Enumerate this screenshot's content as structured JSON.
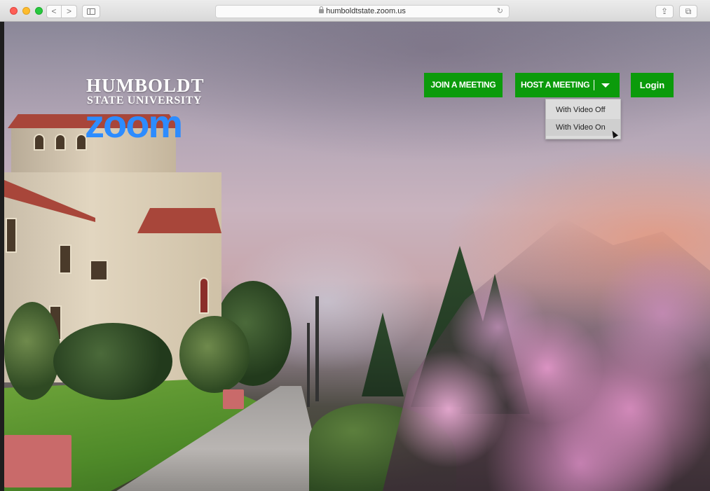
{
  "browser": {
    "url": "humboldtstate.zoom.us",
    "back_glyph": "<",
    "forward_glyph": ">",
    "reload_glyph": "↻",
    "share_glyph": "⇪",
    "tabs_glyph": "⧉",
    "icons": [
      "close-dot",
      "minimize-dot",
      "zoom-dot",
      "back-icon",
      "forward-icon",
      "sidebar-icon",
      "lock-icon",
      "reload-icon",
      "share-icon",
      "tabs-icon"
    ]
  },
  "logo": {
    "line1": "HUMBOLDT",
    "line2": "STATE UNIVERSITY",
    "product": "zoom",
    "product_color": "#2d8cff"
  },
  "actions": {
    "join_label": "JOIN A MEETING",
    "host_label": "HOST A MEETING",
    "login_label": "Login",
    "button_color": "#0b9b0b"
  },
  "host_menu": {
    "items": [
      {
        "label": "With Video Off"
      },
      {
        "label": "With Video On"
      }
    ],
    "hovered_index": 1
  }
}
